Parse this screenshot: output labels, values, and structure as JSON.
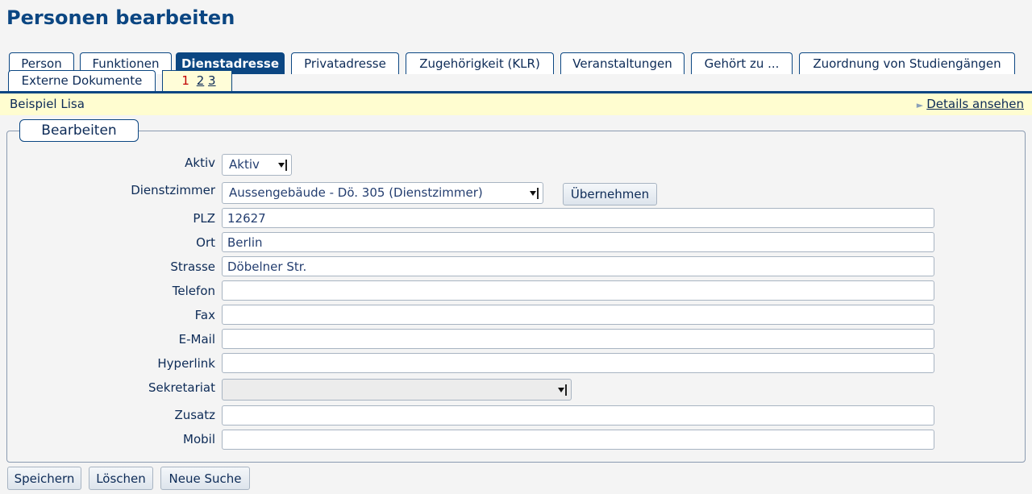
{
  "page": {
    "title": "Personen bearbeiten"
  },
  "tabs": [
    "Person",
    "Funktionen",
    "Dienstadresse",
    "Privatadresse",
    "Zugehörigkeit (KLR)",
    "Veranstaltungen",
    "Gehört zu ...",
    "Zuordnung von Studiengängen",
    "Externe Dokumente"
  ],
  "pagination": {
    "current": "1",
    "p2": "2",
    "p3": "3"
  },
  "record": {
    "name": "Beispiel  Lisa",
    "details_link": "Details ansehen"
  },
  "form": {
    "legend": "Bearbeiten",
    "aktiv": {
      "label": "Aktiv",
      "value": "Aktiv"
    },
    "dienstzimmer": {
      "label": "Dienstzimmer",
      "value": "Aussengebäude - Dö. 305 (Dienstzimmer)",
      "apply_button": "Übernehmen"
    },
    "plz": {
      "label": "PLZ",
      "value": "12627"
    },
    "ort": {
      "label": "Ort",
      "value": "Berlin"
    },
    "strasse": {
      "label": "Strasse",
      "value": "Döbelner Str."
    },
    "telefon": {
      "label": "Telefon",
      "value": ""
    },
    "fax": {
      "label": "Fax",
      "value": ""
    },
    "email": {
      "label": "E-Mail",
      "value": ""
    },
    "hyperlink": {
      "label": "Hyperlink",
      "value": ""
    },
    "sekretariat": {
      "label": "Sekretariat",
      "value": ""
    },
    "zusatz": {
      "label": "Zusatz",
      "value": ""
    },
    "mobil": {
      "label": "Mobil",
      "value": ""
    }
  },
  "actions": {
    "save": "Speichern",
    "delete": "Löschen",
    "new_search": "Neue Suche"
  }
}
